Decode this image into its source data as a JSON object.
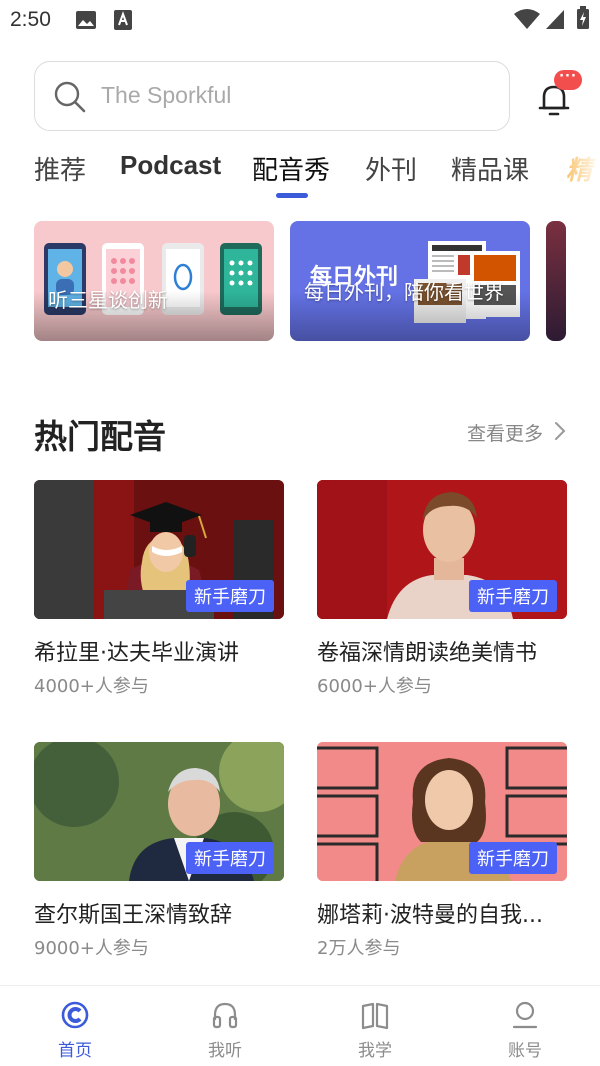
{
  "status_bar": {
    "time": "2:50"
  },
  "search": {
    "placeholder": "The Sporkful",
    "notification_badge": "···"
  },
  "tabs": [
    {
      "label": "推荐"
    },
    {
      "label": "Podcast"
    },
    {
      "label": "配音秀"
    },
    {
      "label": "外刊"
    },
    {
      "label": "精品课"
    },
    {
      "label": "精"
    }
  ],
  "banners": [
    {
      "title": "听三星谈创新"
    },
    {
      "title": "每日外刊，陪你看世界",
      "image_text": "每日外刊"
    }
  ],
  "hot_section": {
    "title": "热门配音",
    "see_more": "查看更多",
    "cards": [
      {
        "title": "希拉里·达夫毕业演讲",
        "participants": "4000+人参与",
        "badge": "新手磨刀"
      },
      {
        "title": "卷福深情朗读绝美情书",
        "participants": "6000+人参与",
        "badge": "新手磨刀"
      },
      {
        "title": "查尔斯国王深情致辞",
        "participants": "9000+人参与",
        "badge": "新手磨刀"
      },
      {
        "title": "娜塔莉·波特曼的自我...",
        "participants": "2万人参与",
        "badge": "新手磨刀"
      }
    ]
  },
  "bottom_nav": [
    {
      "label": "首页",
      "icon": "home-icon",
      "active": true
    },
    {
      "label": "我听",
      "icon": "headphones-icon"
    },
    {
      "label": "我学",
      "icon": "book-icon"
    },
    {
      "label": "账号",
      "icon": "account-icon"
    }
  ],
  "colors": {
    "accent": "#3b5bdb",
    "badge": "#4c61f5",
    "notification": "#f24e4e"
  }
}
